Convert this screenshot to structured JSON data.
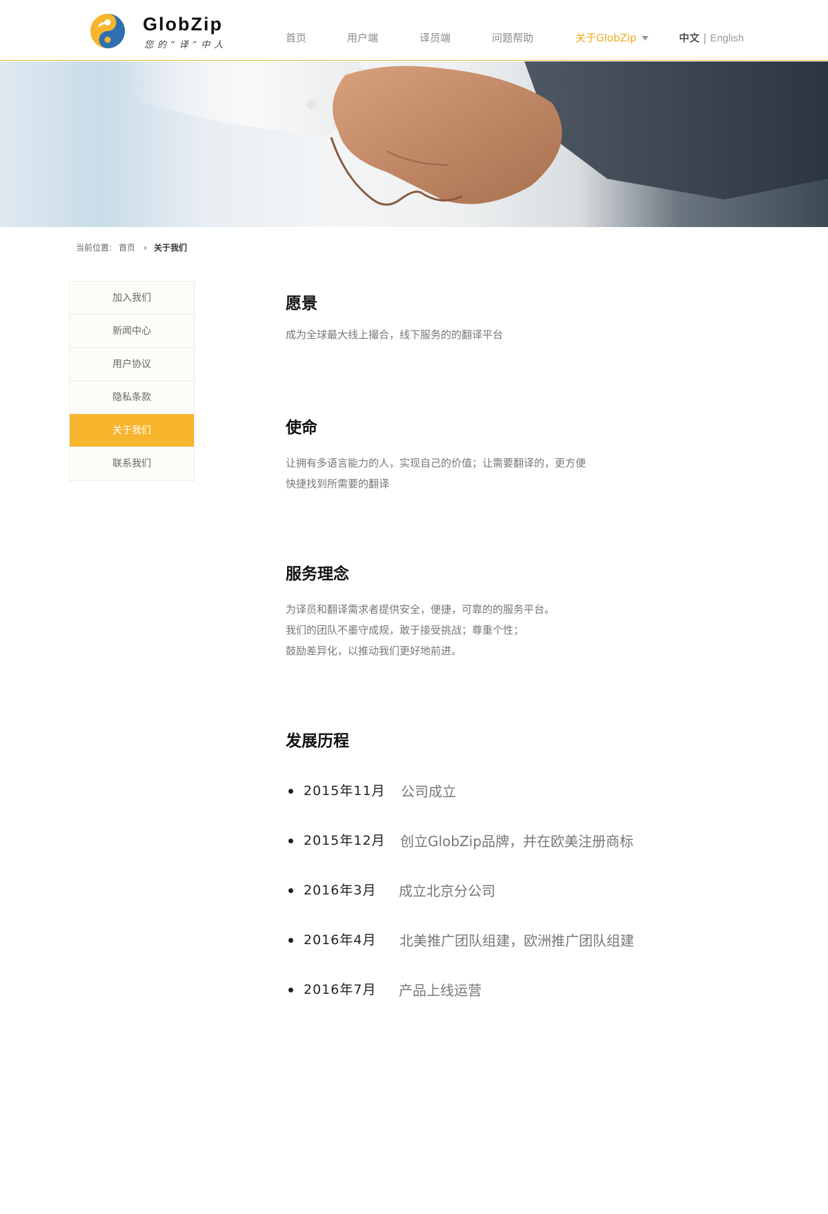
{
  "header": {
    "logo_name": "GlobZip",
    "logo_slogan": "您的“译”中人",
    "nav": [
      {
        "label": "首页"
      },
      {
        "label": "用户端"
      },
      {
        "label": "译员端"
      },
      {
        "label": "问题帮助"
      },
      {
        "label": "关于GlobZip"
      }
    ],
    "lang_zh": "中文",
    "lang_sep": "|",
    "lang_en": "English",
    "accent_color": "#f0a91a"
  },
  "breadcrumb": {
    "prefix": "当前位置:",
    "home": "首页",
    "sep": "›",
    "current": "关于我们"
  },
  "sidebar": {
    "items": [
      {
        "label": "加入我们"
      },
      {
        "label": "新闻中心"
      },
      {
        "label": "用户协议"
      },
      {
        "label": "隐私条款"
      },
      {
        "label": "关于我们",
        "active": true
      },
      {
        "label": "联系我们"
      }
    ],
    "active_color": "#f7b52d"
  },
  "content": {
    "vision": {
      "title": "愿景",
      "lines": [
        "成为全球最大线上撮合，线下服务的的翻译平台"
      ]
    },
    "mission": {
      "title": "使命",
      "lines": [
        "让拥有多语言能力的人，实现自己的价值；让需要翻译的，更方便",
        "快捷找到所需要的翻译"
      ]
    },
    "philosophy": {
      "title": "服务理念",
      "lines": [
        "为译员和翻译需求者提供安全，便捷，可靠的的服务平台。",
        "我们的团队不墨守成规，敢于接受挑战；尊重个性；",
        "鼓励差异化，以推动我们更好地前进。"
      ]
    },
    "history": {
      "title": "发展历程",
      "items": [
        {
          "date": "2015年11月",
          "desc": "公司成立"
        },
        {
          "date": "2015年12月",
          "desc": "创立GlobZip品牌，并在欧美注册商标"
        },
        {
          "date": "2016年3月",
          "desc": "成立北京分公司"
        },
        {
          "date": "2016年4月",
          "desc": "北美推广团队组建，欧洲推广团队组建"
        },
        {
          "date": "2016年7月",
          "desc": "产品上线运营"
        }
      ]
    }
  }
}
